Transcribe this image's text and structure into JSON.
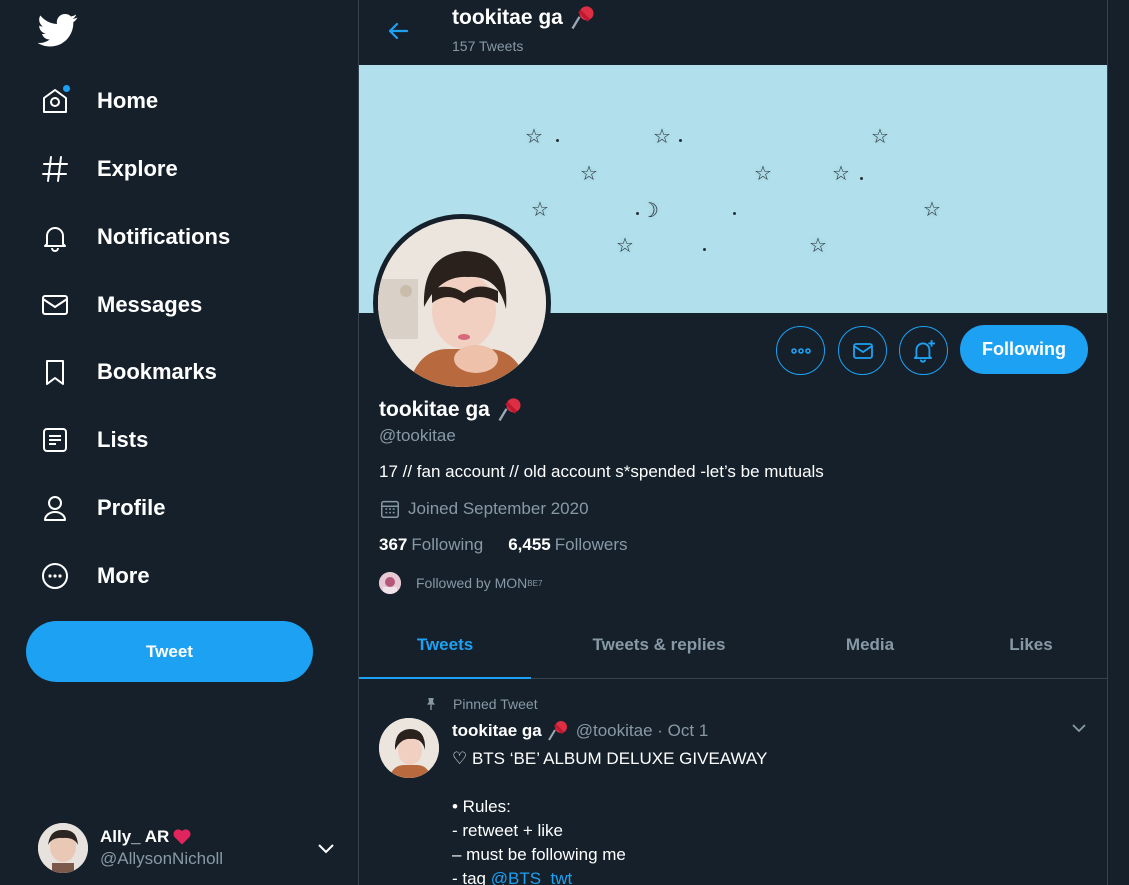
{
  "nav": {
    "home": "Home",
    "explore": "Explore",
    "notifications": "Notifications",
    "messages": "Messages",
    "bookmarks": "Bookmarks",
    "lists": "Lists",
    "profile": "Profile",
    "more": "More",
    "tweet_button": "Tweet"
  },
  "account": {
    "name": "Ally_ AR",
    "handle": "@AllysonNicholl"
  },
  "header": {
    "title": "tookitae ga",
    "tweet_count": "157 Tweets"
  },
  "profile": {
    "name": "tookitae ga",
    "handle": "@tookitae",
    "bio": "17 // fan account // old account s*spended -let’s be mutuals",
    "joined": "Joined September 2020",
    "following_count": "367",
    "following_label": "Following",
    "followers_count": "6,455",
    "followers_label": "Followers",
    "followed_by": "Followed by MON",
    "followed_by_sup": "BE7",
    "follow_button": "Following"
  },
  "tabs": [
    "Tweets",
    "Tweets & replies",
    "Media",
    "Likes"
  ],
  "pinned_tweet": {
    "pinned_label": "Pinned Tweet",
    "name": "tookitae ga",
    "meta": "@tookitae · Oct 1",
    "line1": "♡ BTS ‘BE’ ALBUM DELUXE GIVEAWAY",
    "line2": "",
    "line3": "• Rules:",
    "line4": "- retweet + like",
    "line5": "– must be following me",
    "line6_prefix": "- tag ",
    "line6_link": "@BTS_twt"
  },
  "colors": {
    "background": "#15202b",
    "accent": "#1da1f2",
    "muted_text": "#8899a6",
    "banner": "#b1e0ec",
    "heart": "#e0245e",
    "pin": "#dd2e44"
  }
}
